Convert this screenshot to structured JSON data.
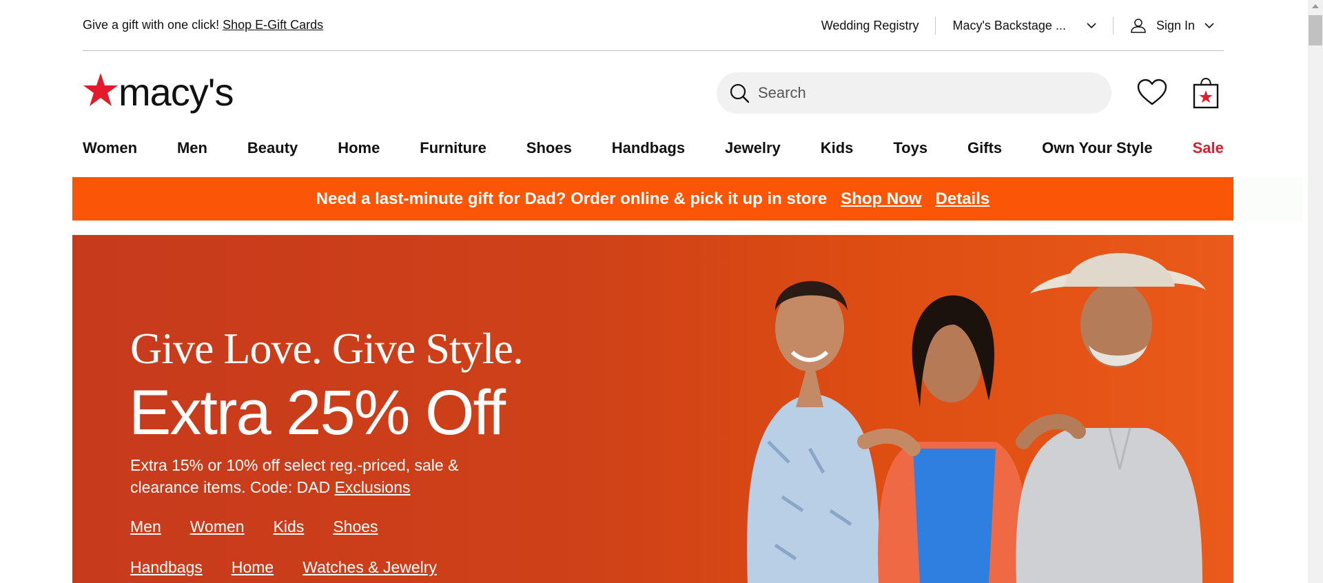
{
  "utility": {
    "gift_text": "Give a gift with one click!",
    "gift_link": "Shop E-Gift Cards",
    "wedding_registry": "Wedding Registry",
    "backstage": "Macy's Backstage ...",
    "sign_in": "Sign In"
  },
  "header": {
    "logo_text": "macy's",
    "search_placeholder": "Search"
  },
  "nav": {
    "items": [
      "Women",
      "Men",
      "Beauty",
      "Home",
      "Furniture",
      "Shoes",
      "Handbags",
      "Jewelry",
      "Kids",
      "Toys",
      "Gifts",
      "Own Your Style",
      "Sale"
    ]
  },
  "promo": {
    "message": "Need a last-minute gift for Dad? Order online & pick it up in store",
    "shop_now": "Shop Now",
    "details": "Details",
    "background_color": "#fb5507"
  },
  "hero": {
    "tagline": "Give Love. Give Style.",
    "headline": "Extra 25% Off",
    "subtext": "Extra 15% or 10% off select reg.-priced, sale & clearance items. Code: DAD",
    "exclusions": "Exclusions",
    "links_row1": [
      "Men",
      "Women",
      "Kids",
      "Shoes"
    ],
    "links_row2": [
      "Handbags",
      "Home",
      "Watches & Jewelry"
    ],
    "background_color": "#cf4118"
  },
  "colors": {
    "brand_red": "#e21a2c",
    "sale_red": "#e21a2c"
  }
}
